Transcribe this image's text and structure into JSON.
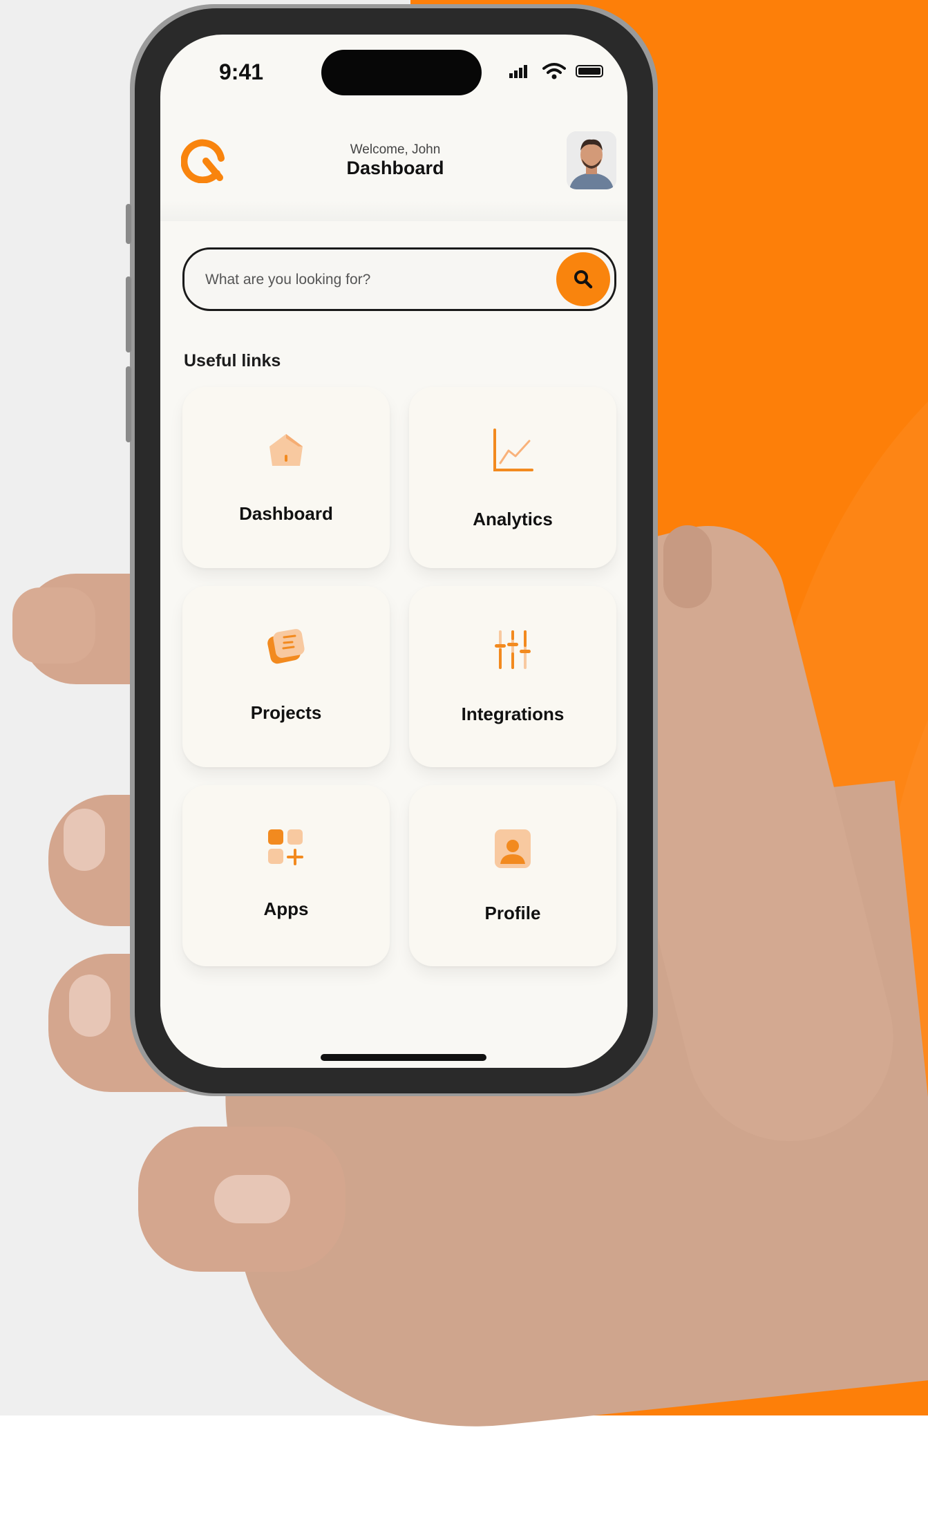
{
  "status_bar": {
    "time": "9:41"
  },
  "header": {
    "welcome": "Welcome, John",
    "title": "Dashboard",
    "logo_icon": "q-logo-icon",
    "avatar_icon": "user-avatar"
  },
  "search": {
    "placeholder": "What are you looking for?",
    "button_icon": "search-icon"
  },
  "useful_links": {
    "title": "Useful links",
    "items": [
      {
        "label": "Dashboard",
        "icon": "home-icon"
      },
      {
        "label": "Analytics",
        "icon": "chart-line-icon"
      },
      {
        "label": "Projects",
        "icon": "projects-icon"
      },
      {
        "label": "Integrations",
        "icon": "sliders-icon"
      },
      {
        "label": "Apps",
        "icon": "apps-grid-icon"
      },
      {
        "label": "Profile",
        "icon": "profile-icon"
      }
    ]
  },
  "colors": {
    "accent": "#f9840d",
    "background_orange": "#fd7f09",
    "screen_bg": "#f9f8f4",
    "text_dark": "#111111"
  }
}
